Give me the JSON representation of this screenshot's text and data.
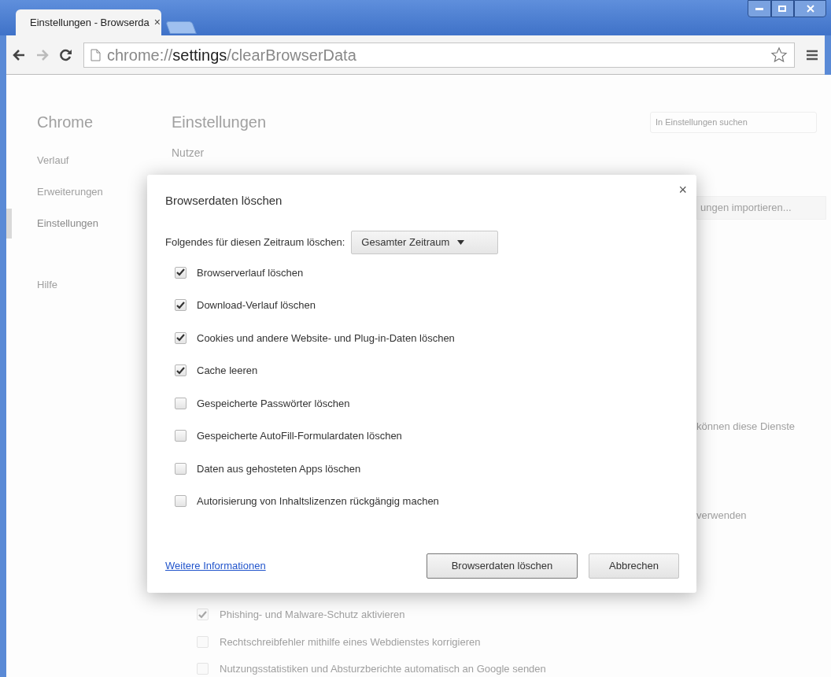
{
  "tabs": [
    {
      "title": "Einstellungen - Browserda",
      "close": "×",
      "selected": true
    }
  ],
  "address_bar": {
    "scheme": "chrome://",
    "host": "settings",
    "path": "/clearBrowserData"
  },
  "sidebar": {
    "title": "Chrome",
    "items": [
      {
        "label": "Verlauf",
        "selected": false
      },
      {
        "label": "Erweiterungen",
        "selected": false
      },
      {
        "label": "Einstellungen",
        "selected": true
      },
      {
        "label": "Hilfe",
        "selected": false
      }
    ]
  },
  "settings_page": {
    "title": "Einstellungen",
    "search": {
      "placeholder": "In Einstellungen suchen"
    },
    "section_heading": "Nutzer",
    "import_button": "ungen importieren...",
    "fragments": [
      "können diese Dienste",
      "verwenden"
    ],
    "options": [
      {
        "label": "Phishing- und Malware-Schutz aktivieren",
        "checked": true
      },
      {
        "label": "Rechtschreibfehler mithilfe eines Webdienstes korrigieren",
        "checked": false
      },
      {
        "label": "Nutzungsstatistiken und Absturzberichte automatisch an Google senden",
        "checked": false
      }
    ]
  },
  "dialog": {
    "title": "Browserdaten löschen",
    "close": "×",
    "period_label": "Folgendes für diesen Zeitraum löschen:",
    "period": "Gesamter Zeitraum",
    "items": [
      {
        "label": "Browserverlauf löschen",
        "checked": true
      },
      {
        "label": "Download-Verlauf löschen",
        "checked": true
      },
      {
        "label": "Cookies und andere Website- und Plug-in-Daten löschen",
        "checked": true
      },
      {
        "label": "Cache leeren",
        "checked": true
      },
      {
        "label": "Gespeicherte Passwörter löschen",
        "checked": false
      },
      {
        "label": "Gespeicherte AutoFill-Formulardaten löschen",
        "checked": false
      },
      {
        "label": "Daten aus gehosteten Apps löschen",
        "checked": false
      },
      {
        "label": "Autorisierung von Inhaltslizenzen rückgängig machen",
        "checked": false
      }
    ],
    "link": "Weitere Informationen",
    "buttons": [
      {
        "label": "Browserdaten löschen",
        "default": true
      },
      {
        "label": "Abbrechen",
        "default": false
      }
    ]
  }
}
